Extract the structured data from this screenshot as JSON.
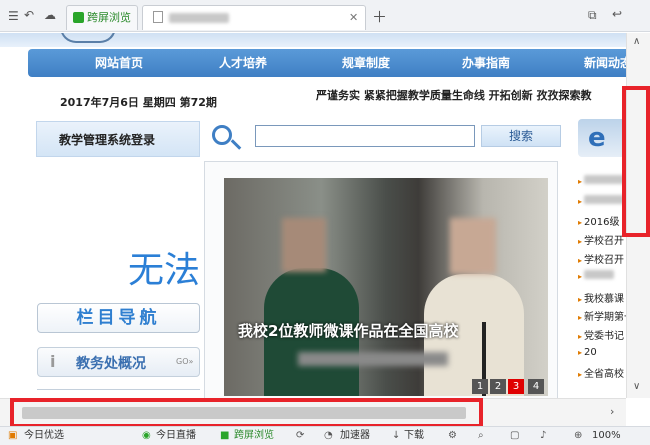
{
  "tabs": {
    "first_tab_label": "跨屏浏览"
  },
  "site": {
    "nav": [
      "网站首页",
      "人才培养",
      "规章制度",
      "办事指南",
      "新闻动态"
    ],
    "date_line": "2017年7月6日 星期四 第72期",
    "marquee": "严谨务实 紧紧把握教学质量生命线 开拓创新 孜孜探索教",
    "login_title": "教学管理系统登录",
    "search_button": "搜索",
    "error_text": "无法",
    "nav_box_label": "栏目导航",
    "about_label": "教务处概况",
    "slide_caption": "我校2位教师微课作品在全国高校",
    "slide_pages": [
      "1",
      "2",
      "3",
      "4"
    ],
    "news_items": [
      "2016级",
      "学校召开",
      "学校召开",
      "我校慕课",
      "新学期第一",
      "党委书记",
      "20",
      "全省高校"
    ]
  },
  "statusbar": {
    "left_label": "今日优选",
    "live_label": "今日直播",
    "cross_label": "跨屏浏览",
    "accel_label": "加速器",
    "download_label": "下载",
    "zoom": "100%"
  },
  "colors": {
    "nav_blue": "#3f7fc4",
    "annotation_red": "#e8232a",
    "green_accent": "#2aa52a",
    "active_page": "#e00000"
  }
}
